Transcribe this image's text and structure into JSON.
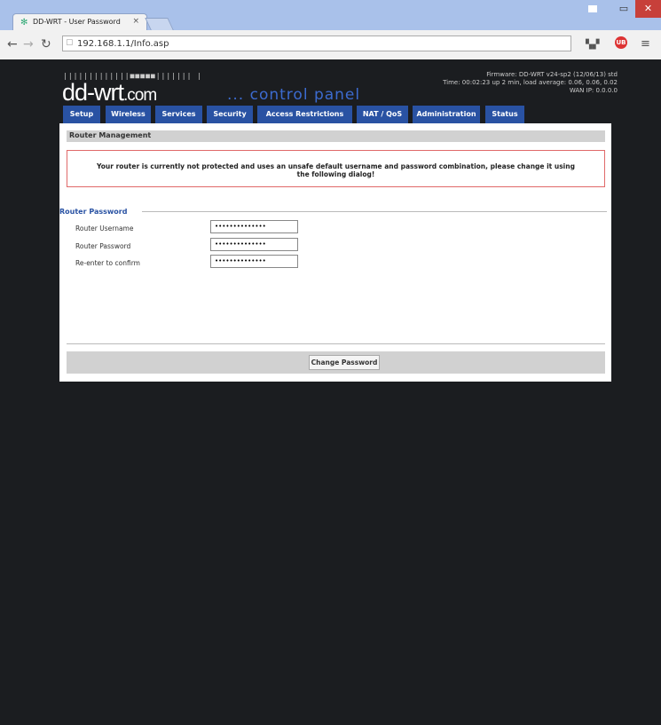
{
  "browser": {
    "tab_title": "DD-WRT - User Password",
    "tab_close": "×",
    "url": "192.168.1.1/Info.asp",
    "ext_label": "UB",
    "icons": {
      "back": "back-arrow-icon",
      "forward": "forward-arrow-icon",
      "reload": "reload-icon",
      "menu": "hamburger-menu-icon"
    }
  },
  "header": {
    "logo_dots": "|||||||||||||■■■■■||||||| |",
    "logo_main": "dd-wrt",
    "logo_dotcom": ".com",
    "control_panel": "... control panel",
    "info_lines": [
      "Firmware: DD-WRT v24-sp2 (12/06/13) std",
      "Time: 00:02:23 up 2 min, load average: 0.06, 0.06, 0.02",
      "WAN IP: 0.0.0.0"
    ]
  },
  "nav": {
    "tabs": [
      "Setup",
      "Wireless",
      "Services",
      "Security",
      "Access Restrictions",
      "NAT / QoS",
      "Administration",
      "Status"
    ]
  },
  "main": {
    "section_title": "Router Management",
    "warning": "Your router is currently not protected and uses an unsafe default username and password combination, please change it using the following dialog!",
    "fieldset_legend": "Router Password",
    "fields": [
      {
        "label": "Router Username",
        "value": "••••••••••••••"
      },
      {
        "label": "Router Password",
        "value": "••••••••••••••"
      },
      {
        "label": "Re-enter to confirm",
        "value": "••••••••••••••"
      }
    ],
    "button_label": "Change Password"
  },
  "colors": {
    "accent": "#2952a3",
    "warning_border": "#e06969",
    "background": "#1b1d20"
  }
}
